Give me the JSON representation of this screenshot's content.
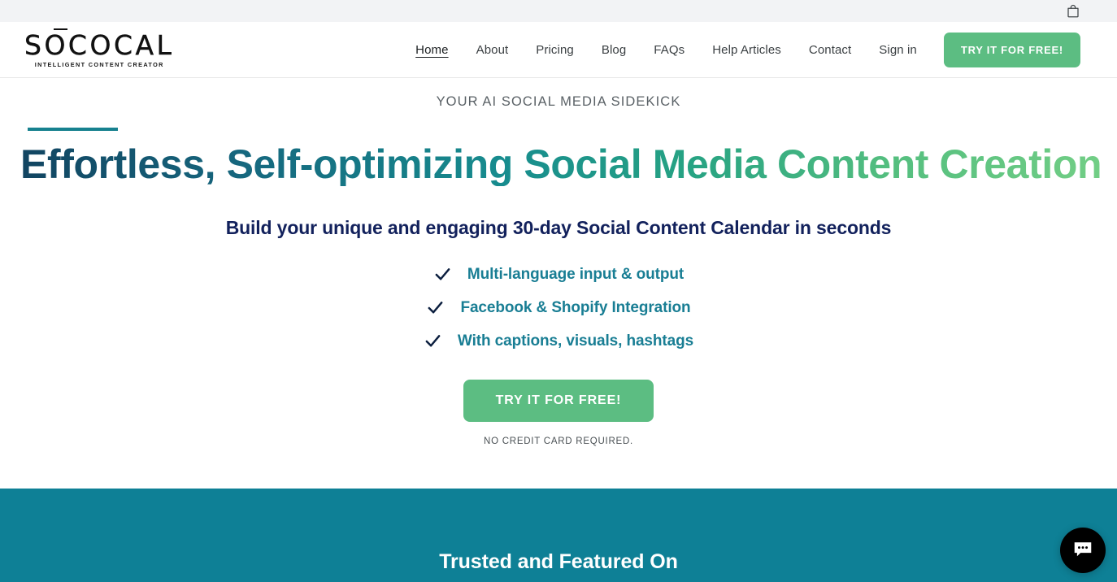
{
  "topbar": {
    "cart_icon": "shopping-bag-icon"
  },
  "header": {
    "logo": {
      "wordmark": "SOCOCAL",
      "tagline": "INTELLIGENT CONTENT CREATOR"
    },
    "nav": [
      {
        "label": "Home",
        "active": true
      },
      {
        "label": "About",
        "active": false
      },
      {
        "label": "Pricing",
        "active": false
      },
      {
        "label": "Blog",
        "active": false
      },
      {
        "label": "FAQs",
        "active": false
      },
      {
        "label": "Help Articles",
        "active": false
      },
      {
        "label": "Contact",
        "active": false
      },
      {
        "label": "Sign in",
        "active": false
      }
    ],
    "cta_label": "TRY IT FOR FREE!"
  },
  "hero": {
    "eyebrow": "YOUR AI SOCIAL MEDIA SIDEKICK",
    "title": "Effortless, Self-optimizing Social Media Content Creation",
    "subtitle": "Build your unique and engaging 30-day Social Content Calendar in seconds",
    "features": [
      {
        "icon": "check-icon",
        "text": "Multi-language input & output"
      },
      {
        "icon": "check-icon",
        "text": "Facebook & Shopify Integration"
      },
      {
        "icon": "check-icon",
        "text": "With captions, visuals, hashtags"
      }
    ],
    "cta_label": "TRY IT FOR FREE!",
    "cta_note": "NO CREDIT CARD REQUIRED."
  },
  "band": {
    "title": "Trusted and Featured On"
  },
  "chat": {
    "icon": "chat-bubble-icon"
  },
  "colors": {
    "topbar_bg": "#f2f3f5",
    "cta_green": "#5cbd82",
    "band_teal": "#0e8096",
    "accent_teal": "#17818f",
    "feature_teal": "#197e94",
    "subtitle_navy": "#12215c",
    "title_gradient_start": "#11415e",
    "title_gradient_end": "#74cf86",
    "chat_bg": "#000000"
  }
}
